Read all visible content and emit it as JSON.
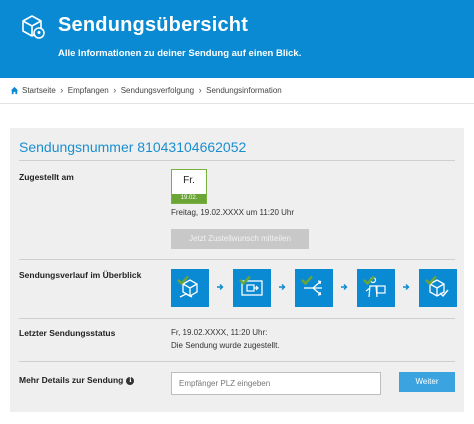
{
  "header": {
    "title": "Sendungsübersicht",
    "subtitle": "Alle Informationen zu deiner Sendung auf einen Blick.",
    "logo_icon": "package-location-icon"
  },
  "breadcrumb": {
    "items": [
      "Startseite",
      "Empfangen",
      "Sendungsverfolgung",
      "Sendungsinformation"
    ],
    "home_icon": "home-icon"
  },
  "shipment": {
    "number_label": "Sendungsnummer 81043104662052"
  },
  "delivered": {
    "label": "Zugestellt am",
    "day": "Fr.",
    "date": "19.02.",
    "datetime": "Freitag, 19.02.XXXX um 11:20 Uhr",
    "button_label": "Jetzt Zustellwunsch mitteilen"
  },
  "history": {
    "label": "Sendungsverlauf im Überblick",
    "steps": [
      "parcel-received-icon",
      "transport-truck-icon",
      "sorting-icon",
      "delivery-person-icon",
      "delivered-parcel-icon"
    ]
  },
  "status": {
    "label": "Letzter Sendungsstatus",
    "line1": "Fr, 19.02.XXXX, 11:20 Uhr:",
    "line2": "Die Sendung wurde zugestellt."
  },
  "details": {
    "label": "Mehr Details zur Sendung",
    "info_glyph": "i",
    "input_placeholder": "Empfänger PLZ eingeben",
    "button_label": "Weiter"
  },
  "colors": {
    "brand_blue": "#0a8ad2",
    "accent_green": "#6aa536",
    "button_blue": "#3ba3e0"
  }
}
